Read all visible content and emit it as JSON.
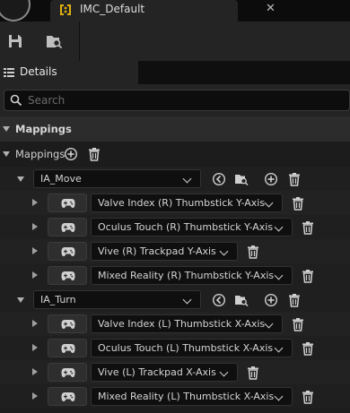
{
  "window": {
    "tab_title": "IMC_Default",
    "close_glyph": "✕"
  },
  "toolbar": {
    "save_icon": "save-icon",
    "browse_icon": "browse-asset-icon"
  },
  "details": {
    "tab_title": "Details",
    "search_placeholder": "Search"
  },
  "category": {
    "label": "Mappings"
  },
  "mappings": {
    "label": "Mappings",
    "actions": [
      {
        "name": "IA_Move",
        "keys": [
          "Valve Index (R) Thumbstick Y-Axis",
          "Oculus Touch (R) Thumbstick Y-Axis",
          "Vive (R) Trackpad Y-Axis",
          "Mixed Reality (R) Thumbstick Y-Axis"
        ]
      },
      {
        "name": "IA_Turn",
        "keys": [
          "Valve Index (L) Thumbstick X-Axis",
          "Oculus Touch (L) Thumbstick X-Axis",
          "Vive (L) Trackpad X-Axis",
          "Mixed Reality (L) Thumbstick X-Axis"
        ]
      }
    ]
  },
  "colors": {
    "background": "#151515",
    "panel": "#242424",
    "accent": "#e0b010",
    "text": "#c0c0c0"
  }
}
